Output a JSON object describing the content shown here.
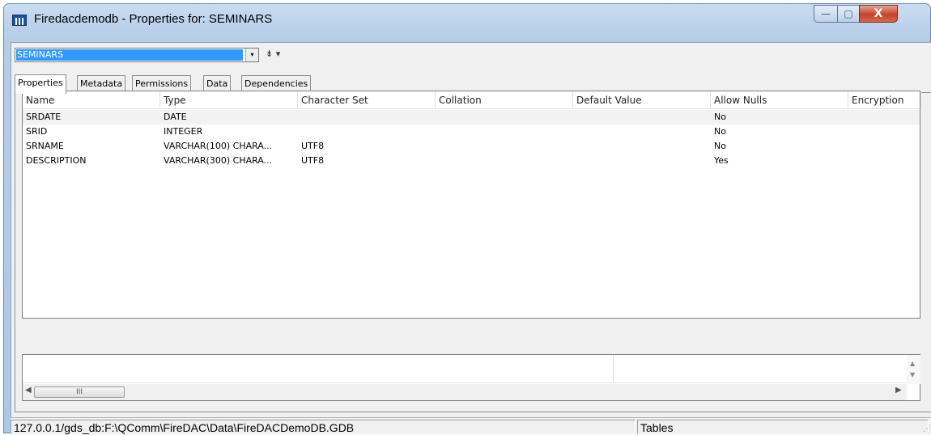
{
  "window": {
    "title": "Firedacdemodb - Properties for: SEMINARS",
    "minimize_glyph": "—",
    "maximize_glyph": "▢",
    "close_glyph": "X"
  },
  "object_selector": {
    "value": "SEMINARS",
    "dropdown_glyph": "▾",
    "tree_menu_glyph": "⇟ ▾"
  },
  "tabs": [
    {
      "label": "Properties",
      "active": true
    },
    {
      "label": "Metadata",
      "active": false
    },
    {
      "label": "Permissions",
      "active": false
    },
    {
      "label": "Data",
      "active": false
    },
    {
      "label": "Dependencies",
      "active": false
    }
  ],
  "toolbar": [
    {
      "icon": "new-document-icon",
      "glyph": "🗋"
    },
    {
      "icon": "lightning-edit-icon",
      "glyph": "⚡"
    },
    {
      "icon": "find-icon",
      "glyph": "⌕"
    },
    {
      "icon": "table-view-icon",
      "glyph": "▦",
      "active": true
    },
    {
      "icon": "script-icon",
      "glyph": "▣"
    },
    {
      "icon": "tree-icon",
      "glyph": "⚑"
    },
    {
      "icon": "grid-icon",
      "glyph": "▩"
    },
    {
      "icon": "lock-icon",
      "glyph": "⛨"
    },
    {
      "icon": "hierarchy-icon",
      "glyph": "♣"
    }
  ],
  "grid": {
    "columns": [
      "Name",
      "Type",
      "Character Set",
      "Collation",
      "Default Value",
      "Allow Nulls",
      "Encryption"
    ],
    "rows": [
      {
        "name": "SRDATE",
        "type": "DATE",
        "charset": "",
        "collation": "",
        "default": "",
        "nulls": "No",
        "encryption": ""
      },
      {
        "name": "SRID",
        "type": "INTEGER",
        "charset": "",
        "collation": "",
        "default": "",
        "nulls": "No",
        "encryption": ""
      },
      {
        "name": "SRNAME",
        "type": "VARCHAR(100) CHARA...",
        "charset": "UTF8",
        "collation": "",
        "default": "",
        "nulls": "No",
        "encryption": ""
      },
      {
        "name": "DESCRIPTION",
        "type": "VARCHAR(300) CHARA...",
        "charset": "UTF8",
        "collation": "",
        "default": "",
        "nulls": "Yes",
        "encryption": ""
      }
    ]
  },
  "scroll": {
    "left_arrow": "◀",
    "right_arrow": "▶",
    "thumb_label": "III",
    "up_arrow": "▲",
    "down_arrow": "▼"
  },
  "statusbar": {
    "path": "127.0.0.1/gds_db:F:\\QComm\\FireDAC\\Data\\FireDACDemoDB.GDB",
    "context": "Tables",
    "grip_glyph": "⋰"
  },
  "colors": {
    "selection": "#3399ff",
    "titlebar": "#b6cde8",
    "close_button": "#c5412b"
  }
}
